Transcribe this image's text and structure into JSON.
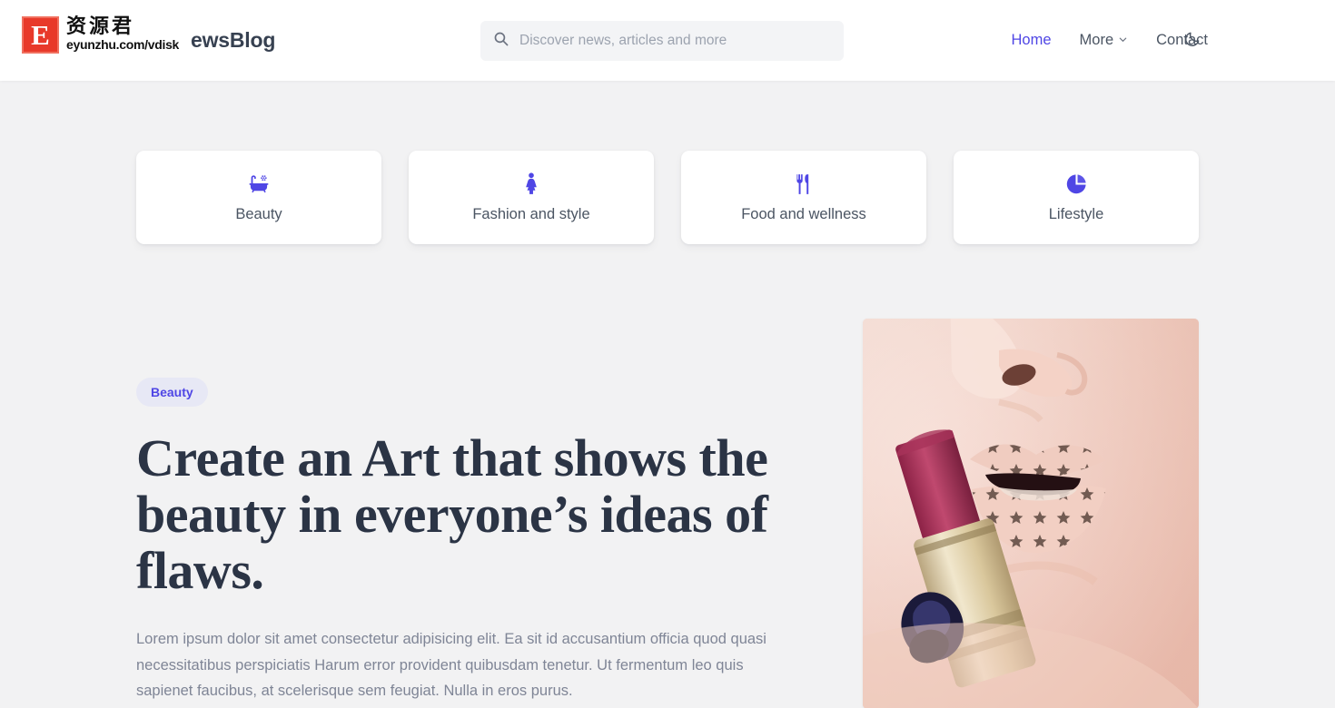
{
  "site": {
    "brand_name": "ewsBlog",
    "watermark": {
      "badge_letter": "E",
      "cn_text": "资源君",
      "url_text": "eyunzhu.com/vdisk"
    }
  },
  "header": {
    "search": {
      "placeholder": "Discover news, articles and more",
      "value": "",
      "icon": "search-icon"
    },
    "nav": [
      {
        "label": "Home",
        "active": true,
        "icon": ""
      },
      {
        "label": "More",
        "active": false,
        "icon": "chevron-down-icon"
      },
      {
        "label": "Contact",
        "active": false,
        "icon": ""
      }
    ],
    "theme_toggle_icon": "moon-icon"
  },
  "categories": [
    {
      "label": "Beauty",
      "icon": "bathtub-icon"
    },
    {
      "label": "Fashion and style",
      "icon": "female-figure-icon"
    },
    {
      "label": "Food and wellness",
      "icon": "fork-knife-icon"
    },
    {
      "label": "Lifestyle",
      "icon": "pie-chart-icon"
    }
  ],
  "hero": {
    "badge": "Beauty",
    "title": "Create an Art that shows the beauty in everyone’s ideas of flaws.",
    "description": "Lorem ipsum dolor sit amet consectetur adipisicing elit. Ea sit id accusantium officia quod quasi necessitatibus perspiciatis Harum error provident quibusdam tenetur. Ut fermentum leo quis sapienet faucibus, at scelerisque sem feugiat. Nulla in eros purus.",
    "image_alt": "close-up of lips with monogram pattern holding a lipstick"
  },
  "colors": {
    "accent": "#4f46e5",
    "page_bg": "#f2f2f3",
    "header_bg": "#ffffff",
    "title_text": "#2b3445",
    "body_text": "#7f8596",
    "badge_bg": "#e7e8f5",
    "watermark_red": "#e8392a"
  }
}
